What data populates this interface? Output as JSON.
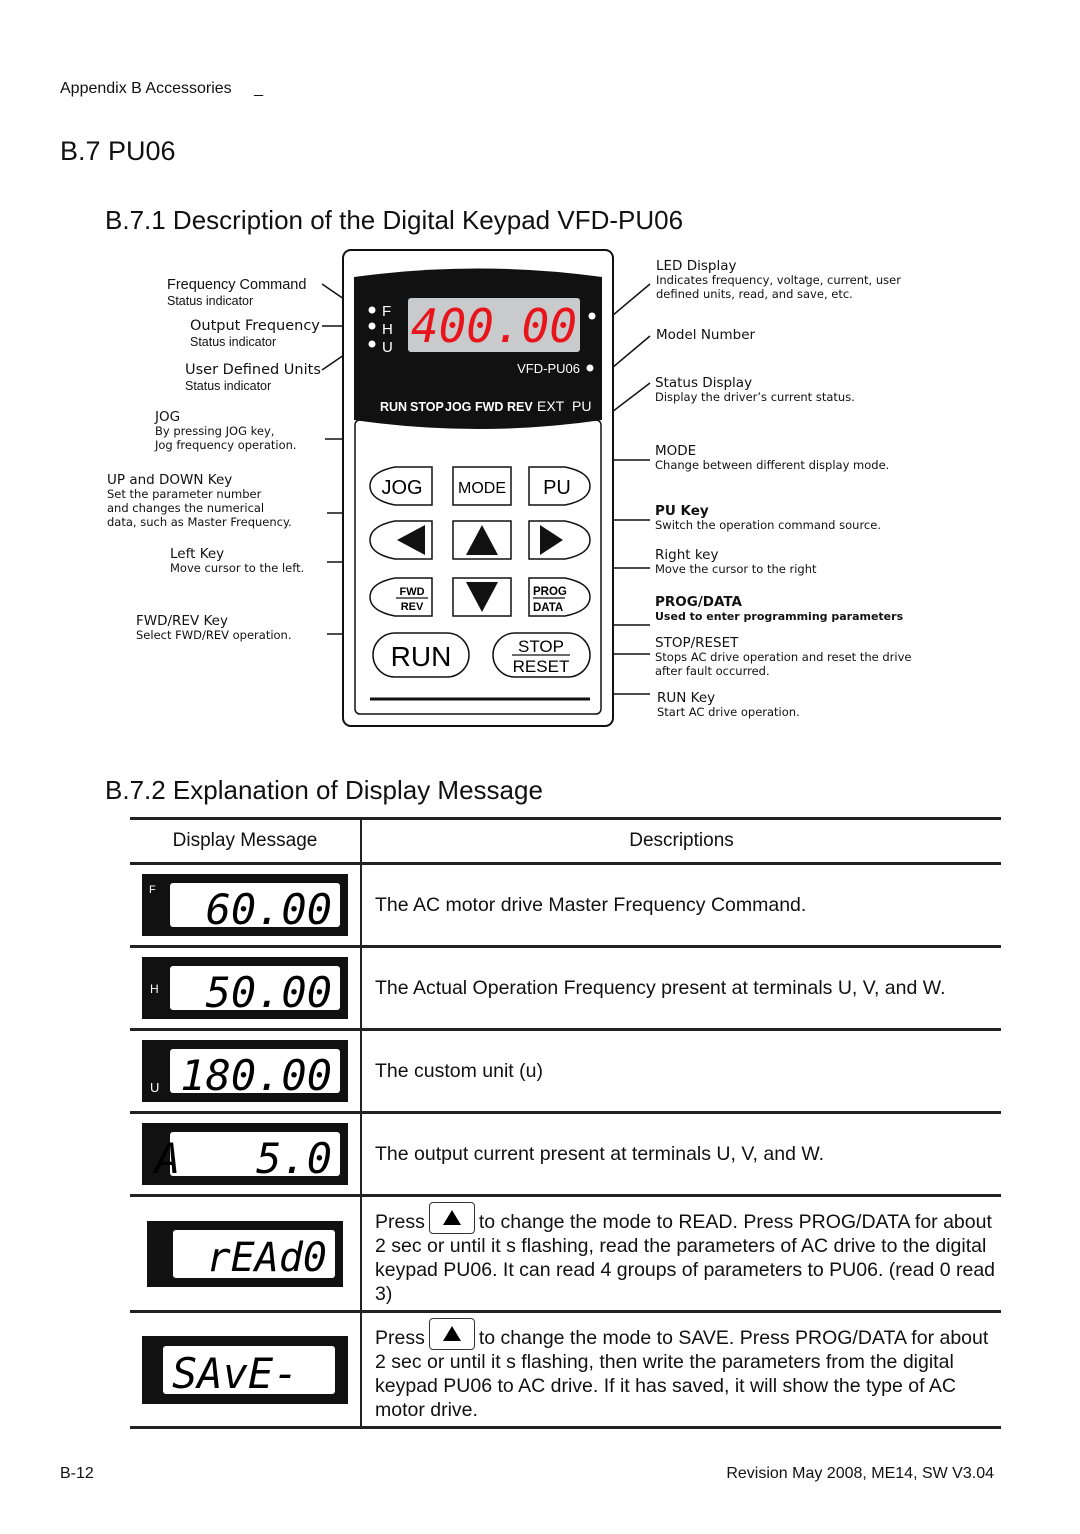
{
  "header": {
    "running_title": "Appendix B Accessories",
    "marker": "_"
  },
  "section": {
    "title": "B.7 PU06"
  },
  "subsection1": {
    "title": "B.7.1 Description of the Digital Keypad VFD-PU06"
  },
  "keypad": {
    "indicators": [
      "F",
      "H",
      "U"
    ],
    "led_value": "400.00",
    "led_color": "#e8141b",
    "model": "VFD-PU06",
    "status_bar": [
      "RUN",
      "STOP",
      "JOG",
      "FWD",
      "REV",
      "EXT",
      "PU"
    ],
    "keys": {
      "jog": "JOG",
      "mode": "MODE",
      "pu": "PU",
      "fwd": "FWD",
      "rev": "REV",
      "prog": "PROG",
      "data": "DATA",
      "run": "RUN",
      "stop": "STOP",
      "reset": "RESET"
    }
  },
  "callouts_left": [
    {
      "title": "Frequency Command",
      "desc": "Status indicator"
    },
    {
      "title": "Output Frequency",
      "desc": "Status indicator"
    },
    {
      "title": "User Defined Units",
      "desc": "Status indicator"
    },
    {
      "title": "JOG",
      "desc": [
        "By pressing JOG key,",
        "Jog frequency operation."
      ]
    },
    {
      "title": "UP and DOWN  Key",
      "desc": [
        "Set the parameter number",
        "and changes the numerical",
        "data, such as Master Frequency."
      ]
    },
    {
      "title": "Left Key",
      "desc": "Move cursor to the left."
    },
    {
      "title": "FWD/REV Key",
      "desc": "Select FWD/REV operation."
    }
  ],
  "callouts_right": [
    {
      "title": "LED Display",
      "desc": [
        "Indicates frequency, voltage, current, user",
        "defined units, read, and save, etc."
      ]
    },
    {
      "title": "Model Number",
      "desc": ""
    },
    {
      "title": "Status Display",
      "desc": "Display the driver’s current status."
    },
    {
      "title": "MODE",
      "desc": "Change between different display mode."
    },
    {
      "title": "PU Key",
      "desc": "Switch the operation command source."
    },
    {
      "title": "Right key",
      "desc": "Move the cursor to the right"
    },
    {
      "title": "PROG/DATA",
      "desc": "Used to enter programming parameters"
    },
    {
      "title": "STOP/RESET",
      "desc": [
        "Stops AC drive operation and reset the drive",
        "after fault occurred."
      ]
    },
    {
      "title": "RUN Key",
      "desc": "Start  AC drive operation."
    }
  ],
  "subsection2": {
    "title": "B.7.2 Explanation of Display Message"
  },
  "table": {
    "headers": [
      "Display Message",
      "Descriptions"
    ],
    "rows": [
      {
        "indicator": "F",
        "display": "60.00",
        "desc": "The AC motor drive Master Frequency Command."
      },
      {
        "indicator": "H",
        "display": "50.00",
        "desc": "The Actual Operation Frequency present at terminals U, V, and W."
      },
      {
        "indicator": "U",
        "display": "180.00",
        "desc": "The custom unit (u)"
      },
      {
        "indicator": "",
        "display": "A   5.0",
        "desc": "The output current present at terminals U, V, and W."
      },
      {
        "indicator": "",
        "display": "rEAd0",
        "desc_pre": "Press",
        "desc": "to change the mode to READ. Press PROG/DATA for about 2 sec or until it s flashing, read the parameters of AC drive to the digital keypad PU06. It can read 4 groups of parameters to PU06. (read 0   read 3)"
      },
      {
        "indicator": "",
        "display": "SAvE-",
        "desc_pre": "Press",
        "desc": "to change the mode to SAVE. Press PROG/DATA for about 2 sec or until it s flashing, then write the parameters from the digital keypad PU06 to AC drive. If it has saved, it will show the type of AC motor drive."
      }
    ]
  },
  "footer": {
    "page": "B-12",
    "revision": "Revision May 2008, ME14, SW V3.04"
  }
}
